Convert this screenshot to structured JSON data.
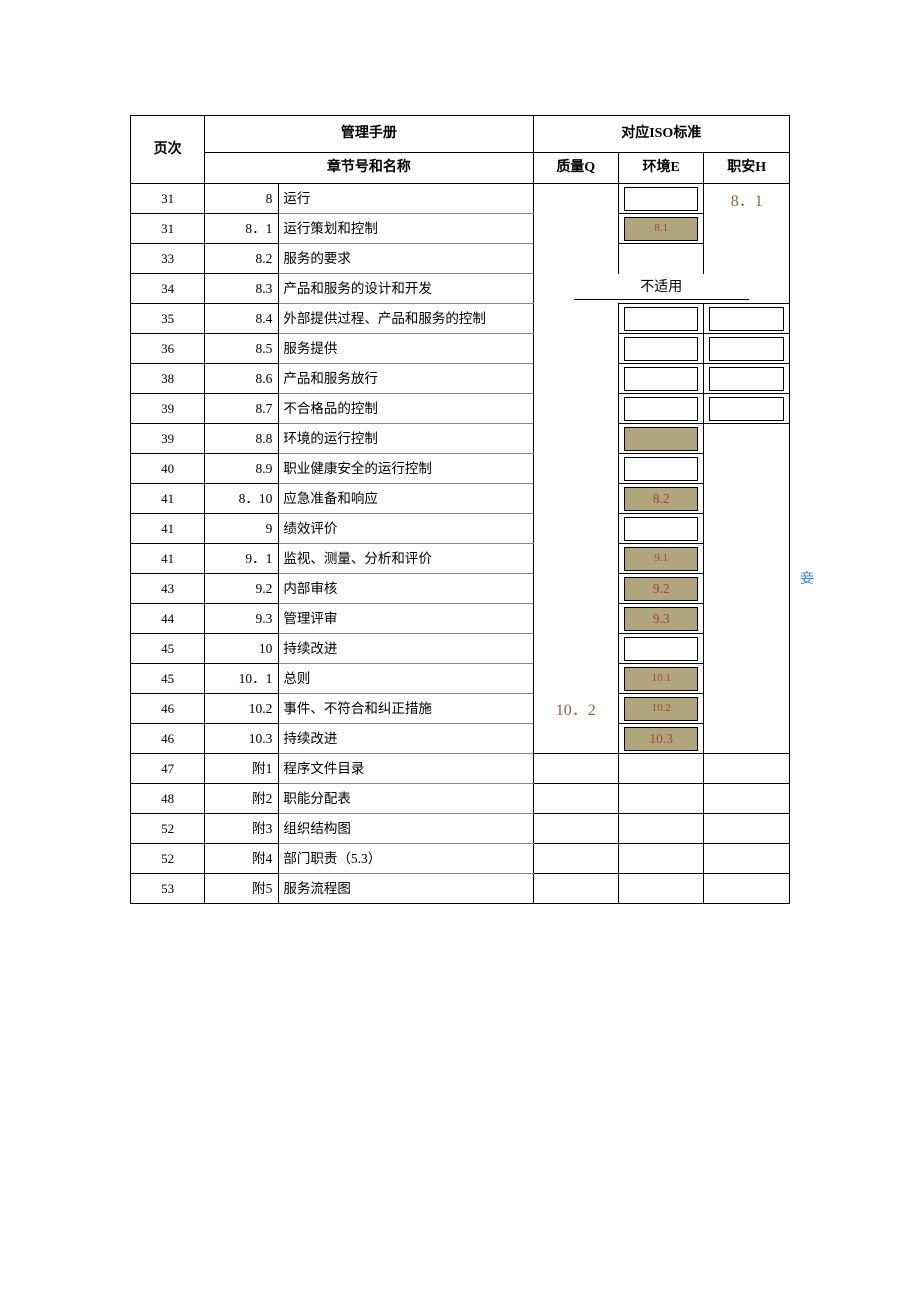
{
  "header": {
    "page_col": "页次",
    "manual": "管理手册",
    "chapter": "章节号和名称",
    "iso": "对应ISO标准",
    "q": "质量Q",
    "e": "环境E",
    "h": "职安H"
  },
  "rows": [
    {
      "page": "31",
      "num": "8",
      "name": "运行"
    },
    {
      "page": "31",
      "num": "8．1",
      "name": "运行策划和控制"
    },
    {
      "page": "33",
      "num": "8.2",
      "name": "服务的要求"
    },
    {
      "page": "34",
      "num": "8.3",
      "name": "产品和服务的设计和开发"
    },
    {
      "page": "35",
      "num": "8.4",
      "name": "外部提供过程、产品和服务的控制"
    },
    {
      "page": "36",
      "num": "8.5",
      "name": "服务提供"
    },
    {
      "page": "38",
      "num": "8.6",
      "name": "产品和服务放行"
    },
    {
      "page": "39",
      "num": "8.7",
      "name": "不合格品的控制"
    },
    {
      "page": "39",
      "num": "8.8",
      "name": "环境的运行控制"
    },
    {
      "page": "40",
      "num": "8.9",
      "name": "职业健康安全的运行控制"
    },
    {
      "page": "41",
      "num": "8．10",
      "name": "应急准备和响应"
    },
    {
      "page": "41",
      "num": "9",
      "name": "绩效评价"
    },
    {
      "page": "41",
      "num": "9．1",
      "name": "监视、测量、分析和评价"
    },
    {
      "page": "43",
      "num": "9.2",
      "name": "内部审核"
    },
    {
      "page": "44",
      "num": "9.3",
      "name": "管理评审"
    },
    {
      "page": "45",
      "num": "10",
      "name": "持续改进"
    },
    {
      "page": "45",
      "num": "10．1",
      "name": "总则"
    },
    {
      "page": "46",
      "num": "10.2",
      "name": "事件、不符合和纠正措施"
    },
    {
      "page": "46",
      "num": "10.3",
      "name": "持续改进"
    },
    {
      "page": "47",
      "num": "附1",
      "name": "程序文件目录"
    },
    {
      "page": "48",
      "num": "附2",
      "name": "职能分配表"
    },
    {
      "page": "52",
      "num": "附3",
      "name": "组织结构图"
    },
    {
      "page": "52",
      "num": "附4",
      "name": "部门职责（5.3）"
    },
    {
      "page": "53",
      "num": "附5",
      "name": "服务流程图"
    }
  ],
  "iso": {
    "e_8_1": "8.1",
    "h_8_1": "8．1",
    "not_applicable": "不适用",
    "e_8_2": "8.2",
    "e_9_1": "9.1",
    "e_9_2": "9.2",
    "e_9_3": "9.3",
    "e_10_1": "10.1",
    "q_10_2": "10．2",
    "e_10_2": "10.2",
    "e_10_3": "10.3"
  },
  "annotation": "妾"
}
